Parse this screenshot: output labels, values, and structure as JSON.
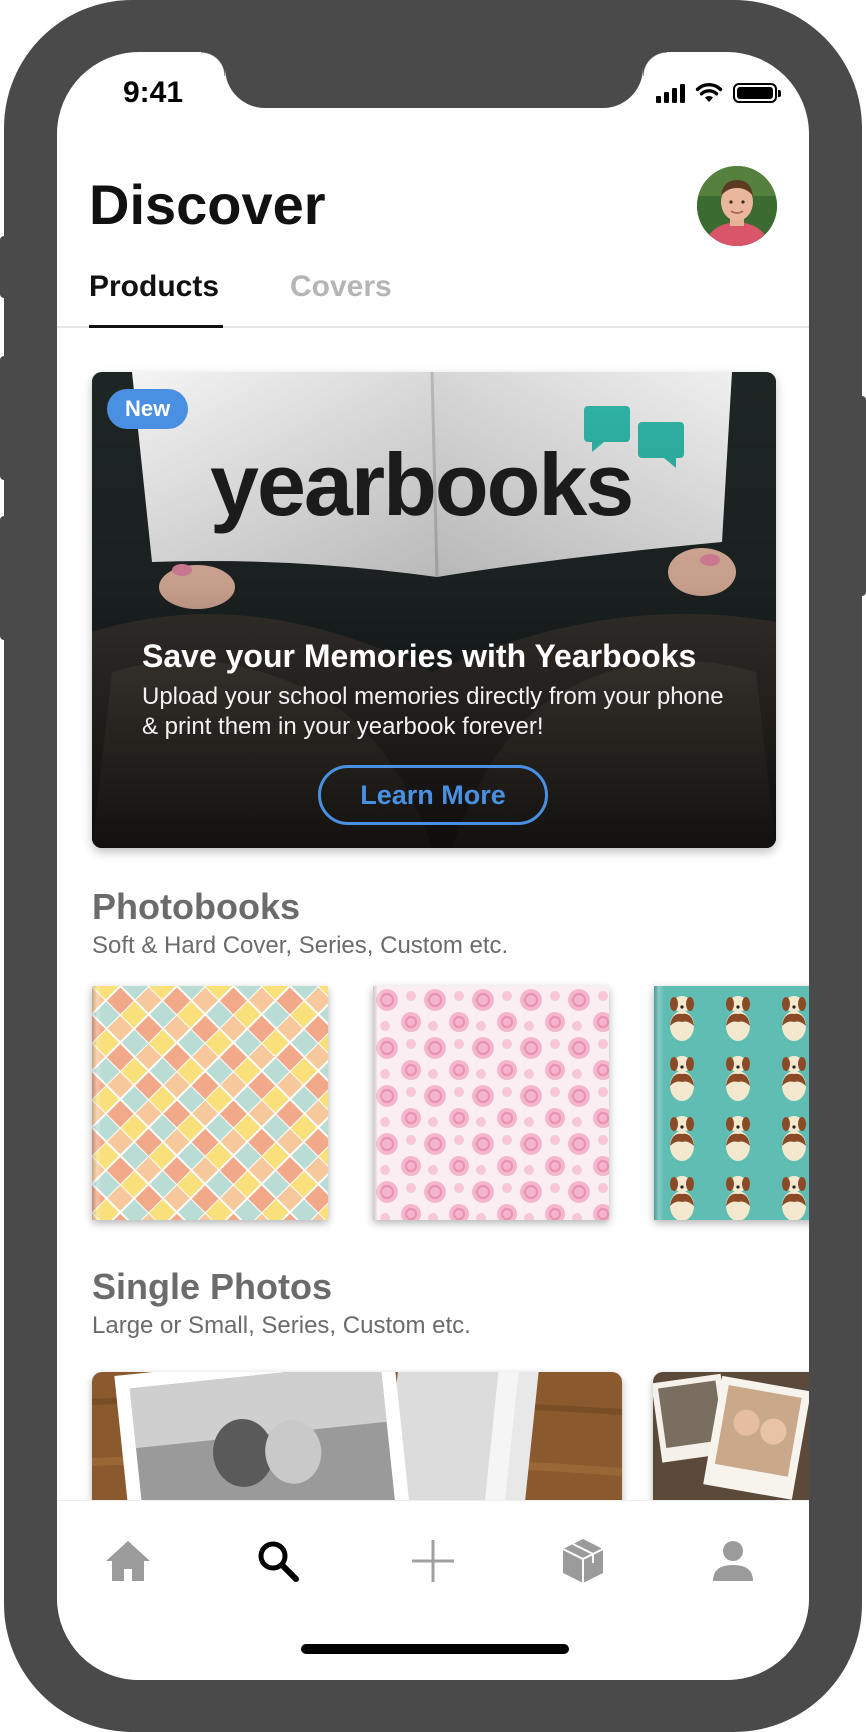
{
  "status_bar": {
    "time": "9:41"
  },
  "header": {
    "title": "Discover"
  },
  "tabs": [
    {
      "label": "Products",
      "active": true
    },
    {
      "label": "Covers",
      "active": false
    }
  ],
  "banner": {
    "badge": "New",
    "brand": "yearbooks",
    "heading": "Save your Memories with Yearbooks",
    "description": "Upload your school memories directly from your phone & print them in your yearbook forever!",
    "button_label": "Learn More",
    "accent_color": "#4a90e2",
    "logo_color": "#2fb5a6"
  },
  "sections": [
    {
      "title": "Photobooks",
      "subtitle": "Soft & Hard Cover, Series, Custom etc.",
      "items": [
        {
          "pattern": "pastel-diamond-pattern"
        },
        {
          "pattern": "pink-rose-pattern"
        },
        {
          "pattern": "dog-pattern"
        }
      ]
    },
    {
      "title": "Single Photos",
      "subtitle": "Large or Small, Series, Custom etc.",
      "items": [
        {
          "pattern": "wedding-photo-prints"
        },
        {
          "pattern": "couple-photo-prints"
        }
      ]
    }
  ],
  "bottom_nav": [
    {
      "icon": "home-icon",
      "active": false
    },
    {
      "icon": "search-icon",
      "active": true
    },
    {
      "icon": "plus-icon",
      "active": false
    },
    {
      "icon": "box-icon",
      "active": false
    },
    {
      "icon": "profile-icon",
      "active": false
    }
  ]
}
